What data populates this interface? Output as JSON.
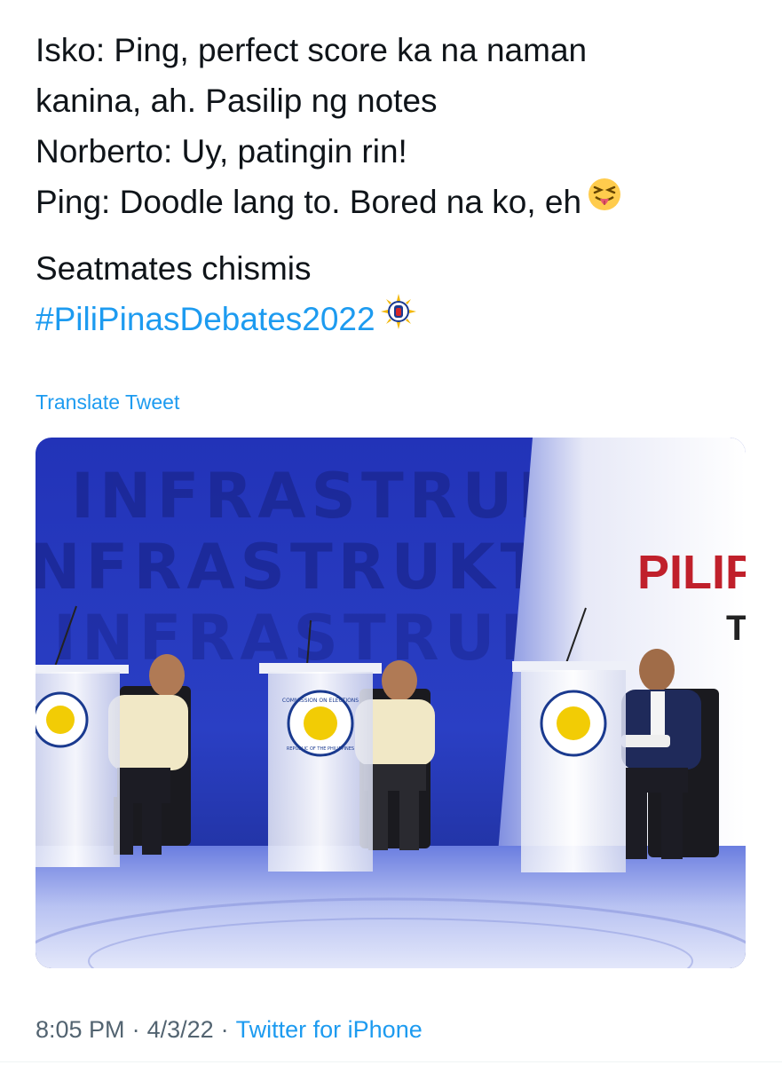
{
  "tweet": {
    "lines": [
      "Isko: Ping, perfect score ka na naman",
      "kanina, ah. Pasilip ng notes",
      "Norberto: Uy, patingin rin!",
      "Ping: Doodle lang to. Bored na ko, eh"
    ],
    "emoji": "squinting-face-with-tongue-icon",
    "caption": "Seatmates chismis",
    "hashtag": "#PiliPinasDebates2022",
    "hashtag_emoji": "debate-logo-icon"
  },
  "translate_label": "Translate Tweet",
  "media": {
    "description_icon": "debate-stage-photo",
    "stage_text_back": "INFRASTRUKTURA",
    "banner_text": "PILIP",
    "banner_sub": "T",
    "podium_seal_text": "COMMISSION ON ELECTIONS",
    "podium_seal_text_bottom": "REPUBLIC OF THE PHILIPPINES"
  },
  "meta": {
    "time": "8:05 PM",
    "separator": "·",
    "date": "4/3/22",
    "source": "Twitter for iPhone"
  },
  "colors": {
    "accent": "#1d9bf0",
    "muted": "#536471",
    "stage_blue": "#2b3fbf"
  }
}
